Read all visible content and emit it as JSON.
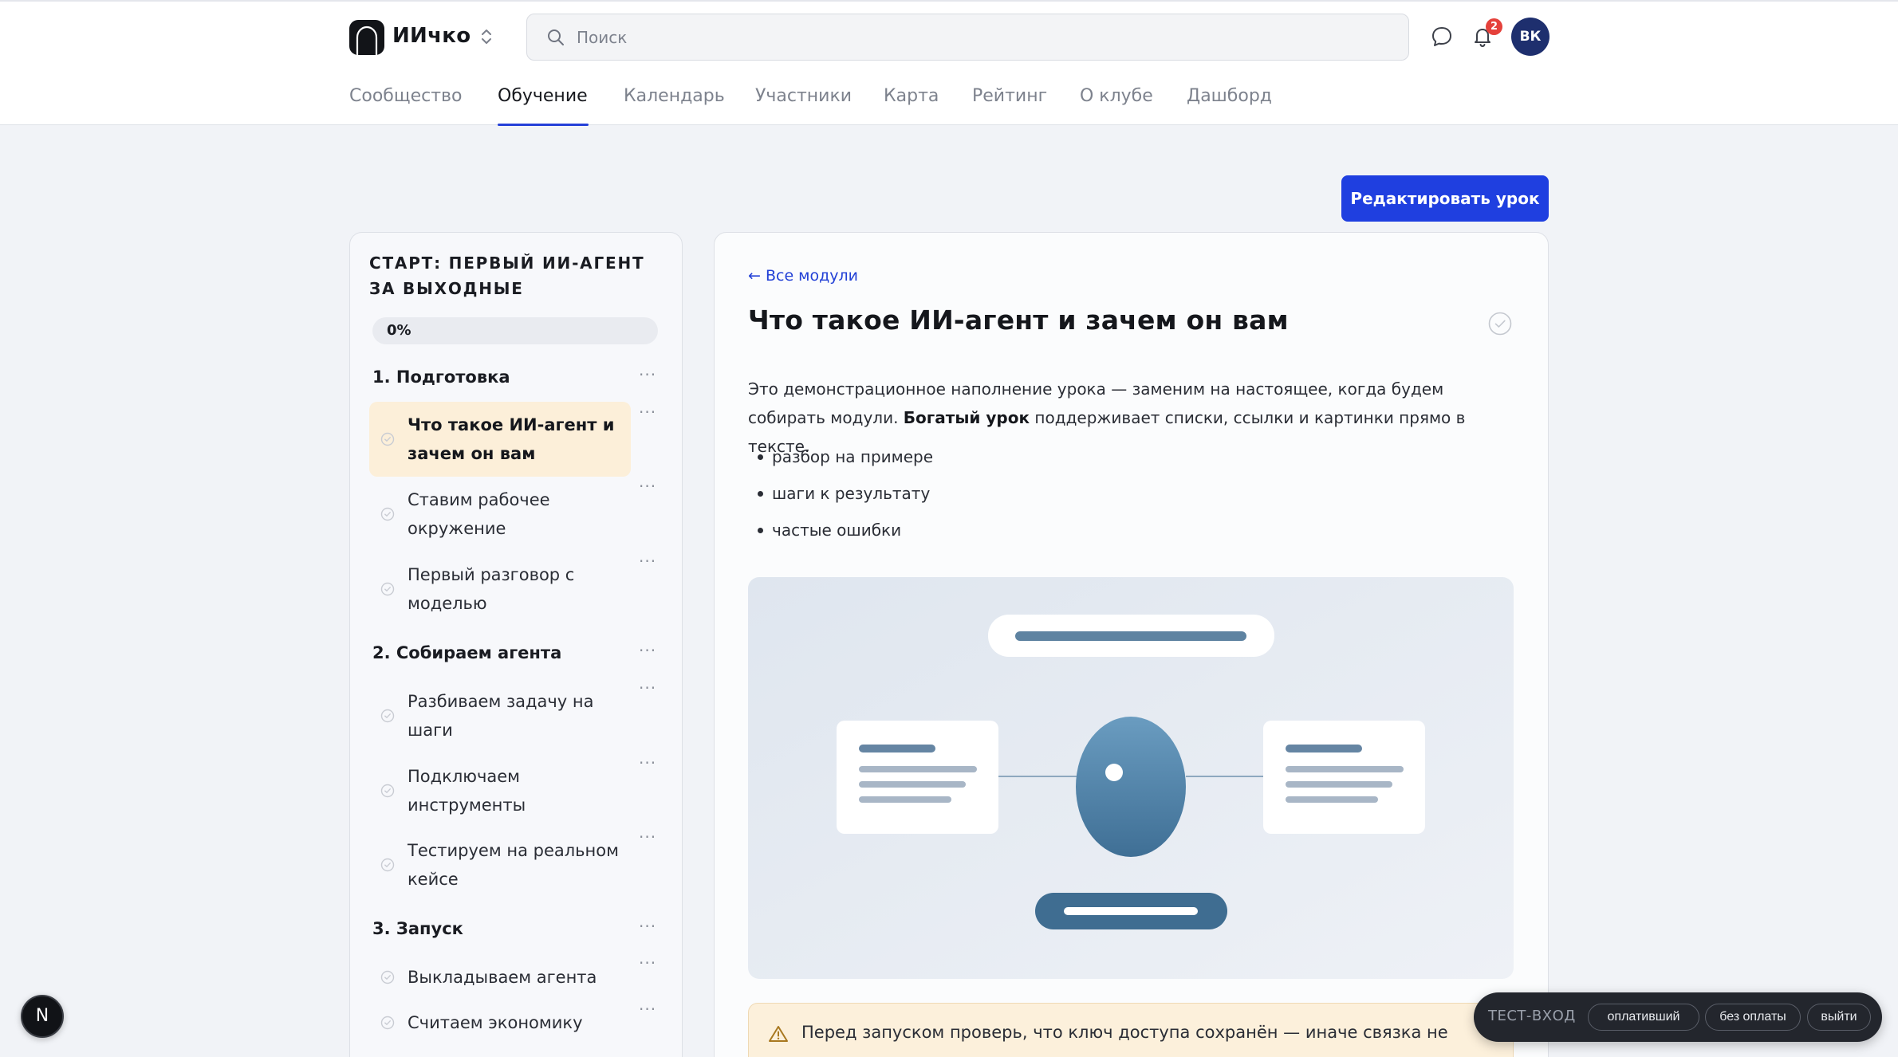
{
  "header": {
    "brand": "ИИчко",
    "search_placeholder": "Поиск",
    "notifications_count": "2",
    "avatar_initials": "ВК"
  },
  "nav": {
    "tabs": [
      "Сообщество",
      "Обучение",
      "Календарь",
      "Участники",
      "Карта",
      "Рейтинг",
      "О клубе",
      "Дашборд"
    ],
    "active": "Обучение"
  },
  "toolbar": {
    "edit_label": "Редактировать урок"
  },
  "course": {
    "title": "СТАРТ: ПЕРВЫЙ ИИ-АГЕНТ ЗА ВЫХОДНЫЕ",
    "progress_label": "0%",
    "progress_value": 0,
    "modules": [
      {
        "title": "1. Подготовка",
        "lessons": [
          {
            "label": "Что такое ИИ-агент и зачем он вам",
            "active": true
          },
          {
            "label": "Ставим рабочее окружение"
          },
          {
            "label": "Первый разговор с моделью"
          }
        ]
      },
      {
        "title": "2. Собираем агента",
        "lessons": [
          {
            "label": "Разбиваем задачу на шаги"
          },
          {
            "label": "Подключаем инструменты"
          },
          {
            "label": "Тестируем на реальном кейсе"
          }
        ]
      },
      {
        "title": "3. Запуск",
        "lessons": [
          {
            "label": "Выкладываем агента"
          },
          {
            "label": "Считаем экономику"
          }
        ]
      }
    ]
  },
  "lesson": {
    "back_link": "← Все модули",
    "title": "Что такое ИИ-агент и зачем он вам",
    "para_1": "Это демонстрационное наполнение урока — заменим на настоящее, когда будем собирать модули.",
    "para_bold": "Богатый урок",
    "para_2": "поддерживает списки, ссылки и картинки прямо в тексте.",
    "bullets": [
      "разбор на примере",
      "шаги к результату",
      "частые ошибки"
    ],
    "warning_text": "Перед запуском проверь, что ключ доступа сохранён — иначе связка не"
  },
  "test_bar": {
    "label": "ТЕСТ-ВХОД",
    "paid": "оплативший",
    "unpaid": "без оплаты",
    "logout": "выйти"
  },
  "next_badge": "N",
  "colors": {
    "accent": "#1f3fe0",
    "active_lesson_bg": "#fcefd9",
    "badge": "#e5413b",
    "avatar": "#1e2f6e"
  }
}
